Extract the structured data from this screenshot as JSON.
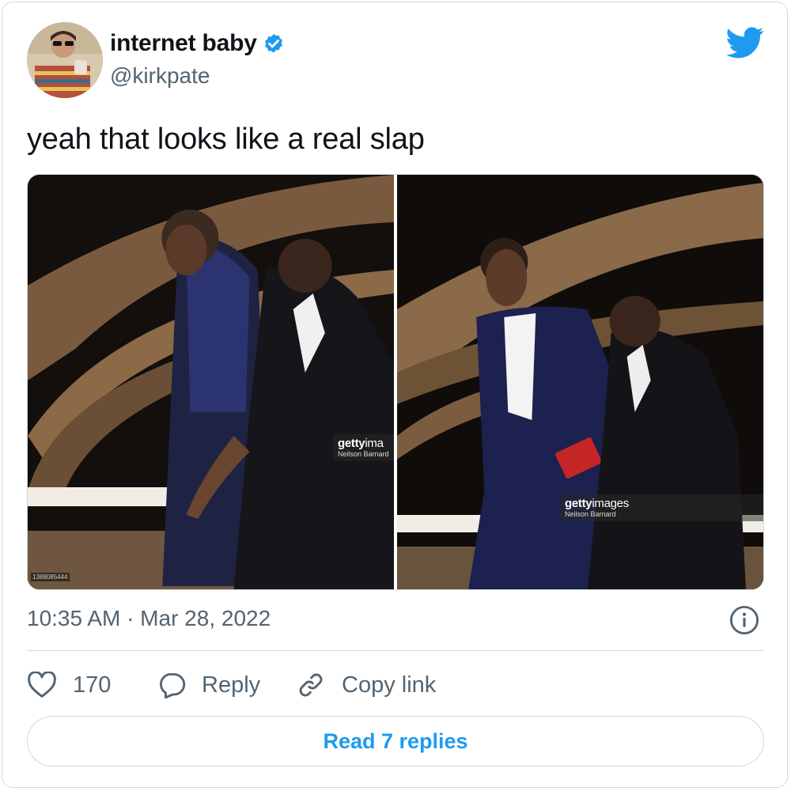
{
  "author": {
    "display_name": "internet baby",
    "handle": "@kirkpate",
    "verified": true
  },
  "tweet": {
    "text": "yeah that looks like a real slap",
    "timestamp": "10:35 AM · Mar 28, 2022"
  },
  "media": {
    "photos": [
      {
        "watermark_brand": "getty",
        "watermark_brand_suffix": "ima",
        "watermark_credit": "Neilson Barnard",
        "photo_id": "1388085444"
      },
      {
        "watermark_brand": "getty",
        "watermark_brand_suffix": "images",
        "watermark_credit": "Neilson Barnard"
      }
    ]
  },
  "actions": {
    "like_count": "170",
    "reply_label": "Reply",
    "copy_link_label": "Copy link"
  },
  "read_replies_label": "Read 7 replies",
  "colors": {
    "accent": "#1d9bf0",
    "secondary_text": "#536471",
    "border": "#cfd9de"
  },
  "icons": [
    "verified-badge-icon",
    "twitter-bird-icon",
    "info-icon",
    "heart-icon",
    "speech-bubble-icon",
    "link-icon"
  ]
}
